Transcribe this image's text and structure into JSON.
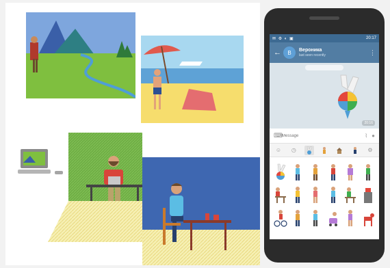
{
  "chat": {
    "contact_name": "Вероника",
    "contact_initial": "В",
    "last_seen": "last seen recently",
    "status_time": "20:17",
    "message_time": "20:16"
  },
  "composer": {
    "placeholder": "Message"
  },
  "icons": {
    "back": "arrow-back-icon",
    "more": "more-vert-icon",
    "emoji": "keyboard-icon",
    "attach": "paperclip-icon",
    "mic": "microphone-icon",
    "recent": "clock-icon",
    "settings": "gear-icon"
  },
  "colors": {
    "header": "#527da3",
    "statusbar": "#3d6a92",
    "phone_body": "#2b2b2b"
  }
}
